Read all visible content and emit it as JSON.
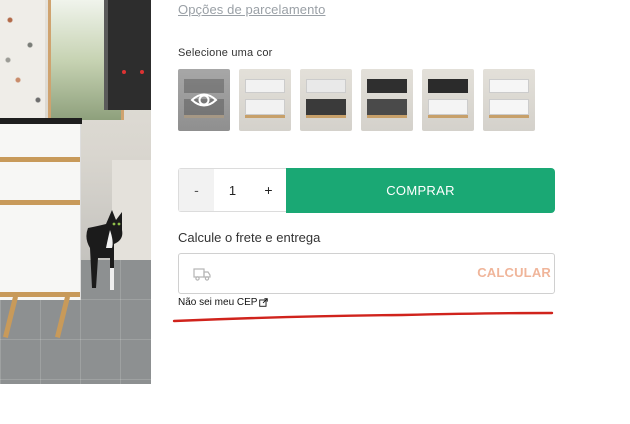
{
  "installments_link": "Opções de parcelamento",
  "color_section": {
    "label": "Selecione uma cor",
    "swatches": [
      {
        "selected": true,
        "top_color": "#3c3c3c",
        "bottom_color": "#3c3c3c",
        "icon": "eye-icon"
      },
      {
        "selected": false,
        "top_color": "#f2f2f2",
        "bottom_color": "#f2f2f2"
      },
      {
        "selected": false,
        "top_color": "#e9e9e9",
        "bottom_color": "#3a3a3a"
      },
      {
        "selected": false,
        "top_color": "#2f2f2f",
        "bottom_color": "#4a4a4a"
      },
      {
        "selected": false,
        "top_color": "#2b2b2b",
        "bottom_color": "#f4f4f4"
      },
      {
        "selected": false,
        "top_color": "#f6f6f6",
        "bottom_color": "#f6f6f6"
      }
    ]
  },
  "quantity": {
    "minus": "-",
    "value": "1",
    "plus": "+"
  },
  "buy_button": {
    "label": "COMPRAR",
    "color": "#1aa874"
  },
  "shipping": {
    "label": "Calcule o frete e entrega",
    "input_value": "",
    "input_icon": "truck-icon",
    "calc_label": "CALCULAR",
    "calc_color": "#f0b59a",
    "unknown_cep_link": "Não sei meu CEP",
    "unknown_cep_icon": "external-link-icon"
  },
  "annotation": {
    "shape": "underline",
    "color": "#d0231c"
  }
}
